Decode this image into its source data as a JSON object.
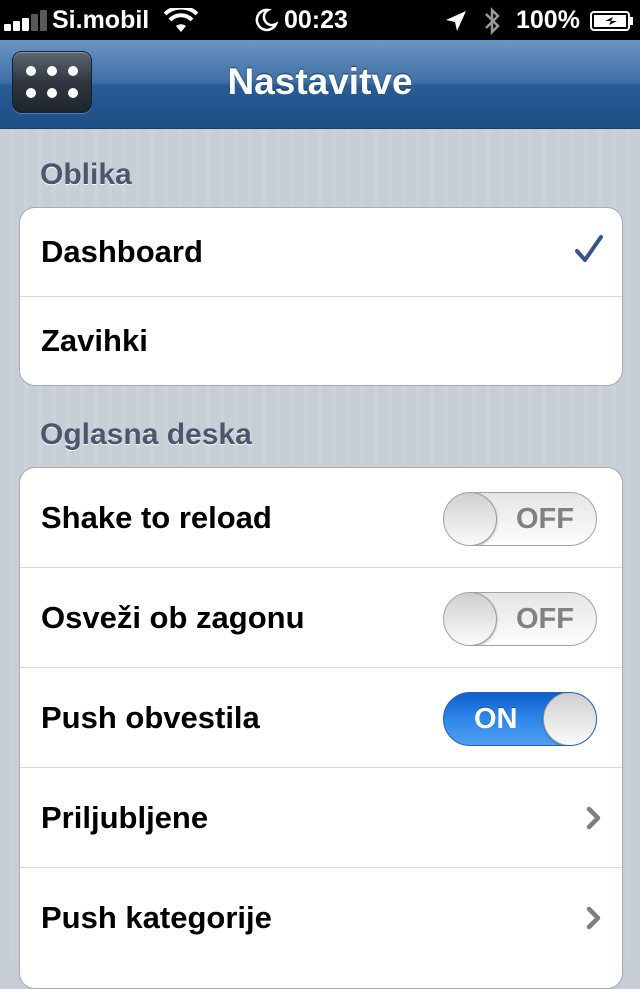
{
  "status_bar": {
    "carrier": "Si.mobil",
    "time": "00:23",
    "battery": "100%",
    "icons": [
      "signal-icon",
      "wifi-icon",
      "moon-icon",
      "location-icon",
      "bluetooth-icon",
      "battery-icon"
    ]
  },
  "nav": {
    "title": "Nastavitve",
    "menu_icon": "grid-dots-icon"
  },
  "sections": [
    {
      "header": "Oblika",
      "rows": [
        {
          "label": "Dashboard",
          "selected": true
        },
        {
          "label": "Zavihki",
          "selected": false
        }
      ]
    },
    {
      "header": "Oglasna deska",
      "rows": [
        {
          "label": "Shake to reload",
          "switch": "OFF"
        },
        {
          "label": "Osveži ob zagonu",
          "switch": "OFF"
        },
        {
          "label": "Push obvestila",
          "switch": "ON"
        },
        {
          "label": "Priljubljene",
          "accessory": "chevron-right-icon"
        },
        {
          "label": "Push kategorije",
          "accessory": "chevron-right-icon"
        }
      ]
    }
  ],
  "colors": {
    "nav_bar": "#275c95",
    "switch_on": "#2f86ea",
    "checkmark": "#385487",
    "section_header": "#4c566c"
  }
}
